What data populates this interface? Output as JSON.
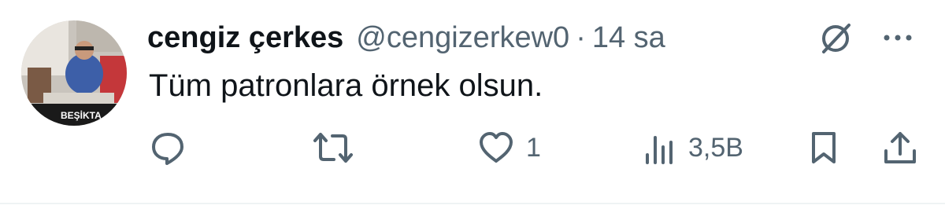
{
  "tweet": {
    "author_name": "cengiz çerkes",
    "handle": "@cengizerkew0",
    "separator": "·",
    "time": "14 sa",
    "text": "Tüm patronlara örnek olsun.",
    "avatar_badge": "BEŞİKTA"
  },
  "actions": {
    "reply_count": "",
    "retweet_count": "",
    "like_count": "1",
    "views_count": "3,5B"
  },
  "icons": [
    "grok-icon",
    "more-icon",
    "reply-icon",
    "retweet-icon",
    "like-icon",
    "views-icon",
    "bookmark-icon",
    "share-icon"
  ],
  "colors": {
    "text": "#0f1419",
    "secondary": "#536471"
  }
}
